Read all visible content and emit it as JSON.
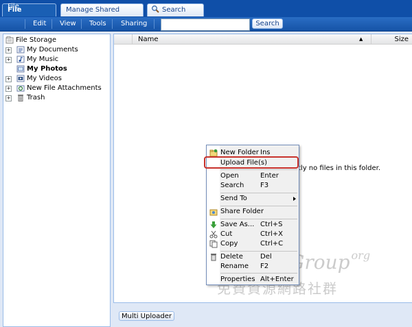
{
  "tabs": [
    {
      "label": "File Storage",
      "active": true
    },
    {
      "label": "Manage Shared Folders",
      "active": false
    },
    {
      "label": "Search Files",
      "active": false,
      "icon": "magnifier-icon"
    }
  ],
  "menu": [
    "File",
    "Edit",
    "View",
    "Tools",
    "Sharing"
  ],
  "search": {
    "value": "",
    "button": "Search"
  },
  "tree": {
    "root": "File Storage",
    "items": [
      {
        "label": "My Documents",
        "icon": "documents-folder-icon",
        "expandable": true,
        "bold": false
      },
      {
        "label": "My Music",
        "icon": "music-folder-icon",
        "expandable": true,
        "bold": false
      },
      {
        "label": "My Photos",
        "icon": "photos-folder-icon",
        "expandable": false,
        "bold": true
      },
      {
        "label": "My Videos",
        "icon": "videos-folder-icon",
        "expandable": true,
        "bold": false
      },
      {
        "label": "New File Attachments",
        "icon": "attachments-folder-icon",
        "expandable": true,
        "bold": false
      },
      {
        "label": "Trash",
        "icon": "trash-icon",
        "expandable": true,
        "bold": false
      }
    ]
  },
  "list": {
    "columns": [
      "Name",
      "Size"
    ],
    "empty_message": "tly no files in this folder."
  },
  "context_menu": {
    "items": [
      {
        "label": "New Folder",
        "key": "Ins",
        "icon": "new-folder-icon"
      },
      {
        "label": "Upload File(s)",
        "key": "",
        "highlighted": true
      },
      {
        "label": "Open",
        "key": "Enter"
      },
      {
        "label": "Search",
        "key": "F3"
      },
      {
        "label": "Send To",
        "key": "",
        "submenu": true
      },
      {
        "label": "Share Folder",
        "key": "",
        "icon": "share-folder-icon"
      },
      {
        "label": "Save As...",
        "key": "Ctrl+S",
        "icon": "save-icon"
      },
      {
        "label": "Cut",
        "key": "Ctrl+X",
        "icon": "cut-icon"
      },
      {
        "label": "Copy",
        "key": "Ctrl+C",
        "icon": "copy-icon"
      },
      {
        "label": "Delete",
        "key": "Del",
        "icon": "delete-icon"
      },
      {
        "label": "Rename",
        "key": "F2"
      },
      {
        "label": "Properties",
        "key": "Alt+Enter"
      }
    ]
  },
  "bottom": {
    "multi_uploader": "Multi Uploader"
  },
  "watermark": {
    "latin": "FreeGroup",
    "suffix": "org",
    "cjk": "免費資源網路社群"
  },
  "colors": {
    "accent": "#1553a6",
    "highlight_border": "#c8322c",
    "panel_border": "#99bbe8"
  }
}
